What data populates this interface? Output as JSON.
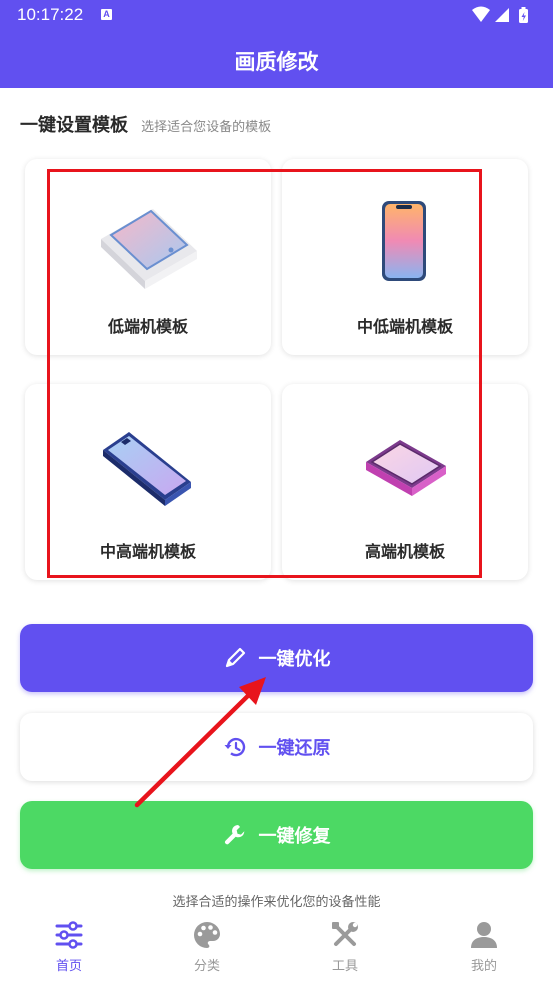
{
  "status_bar": {
    "time": "10:17:22",
    "notification_glyph": "A"
  },
  "app_bar": {
    "title": "画质修改"
  },
  "section": {
    "title": "一键设置模板",
    "subtitle": "选择适合您设备的模板"
  },
  "templates": [
    {
      "label": "低端机模板",
      "icon": "tablet-flat-icon"
    },
    {
      "label": "中低端机模板",
      "icon": "phone-upright-icon"
    },
    {
      "label": "中高端机模板",
      "icon": "phone-tilted-icon"
    },
    {
      "label": "高端机模板",
      "icon": "foldable-phone-icon"
    }
  ],
  "actions": {
    "optimize_label": "一键优化",
    "restore_label": "一键还原",
    "repair_label": "一键修复"
  },
  "footer_hint": "选择合适的操作来优化您的设备性能",
  "bottom_nav": [
    {
      "label": "首页",
      "icon": "sliders-icon",
      "active": true
    },
    {
      "label": "分类",
      "icon": "palette-icon",
      "active": false
    },
    {
      "label": "工具",
      "icon": "tools-icon",
      "active": false
    },
    {
      "label": "我的",
      "icon": "person-icon",
      "active": false
    }
  ],
  "colors": {
    "primary": "#6150f0",
    "success": "#4cd964",
    "annotation": "#e8141c"
  }
}
